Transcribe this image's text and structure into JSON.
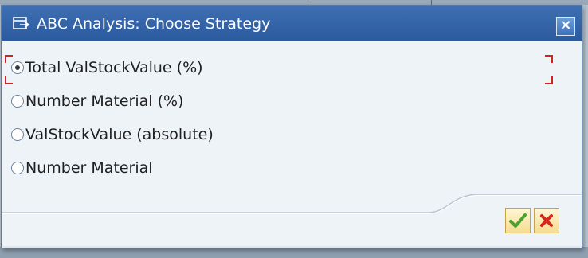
{
  "dialog": {
    "title": "ABC Analysis: Choose Strategy",
    "close_label": "×"
  },
  "options": [
    {
      "label": "Total ValStockValue (%)",
      "selected": true
    },
    {
      "label": "Number Material (%)",
      "selected": false
    },
    {
      "label": "ValStockValue (absolute)",
      "selected": false
    },
    {
      "label": "Number Material",
      "selected": false
    }
  ],
  "buttons": {
    "ok_icon": "green-check-icon",
    "cancel_icon": "red-x-icon"
  },
  "colors": {
    "title_bar": "#2b5a9e",
    "focus_marker": "#d42020",
    "ok": "#4aa12e",
    "cancel": "#d9261c"
  }
}
